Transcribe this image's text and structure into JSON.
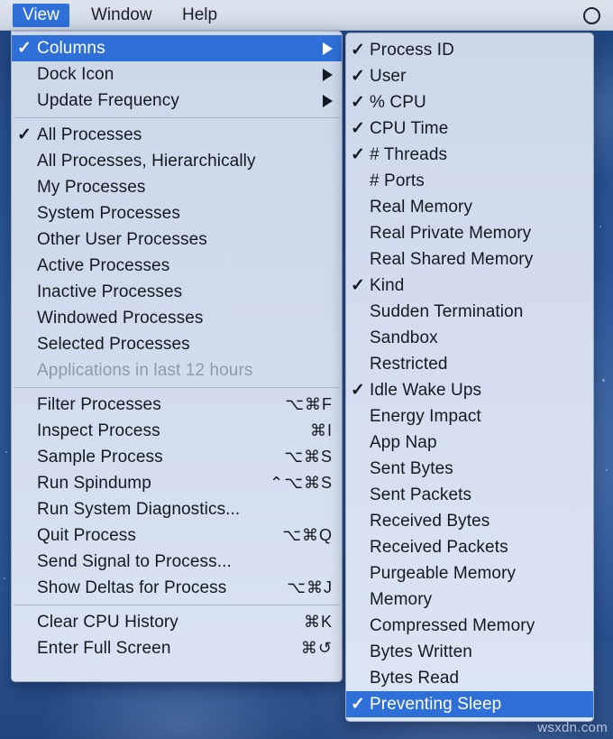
{
  "menubar": {
    "items": [
      {
        "label": "View",
        "active": true
      },
      {
        "label": "Window",
        "active": false
      },
      {
        "label": "Help",
        "active": false
      }
    ],
    "right_icon": "circle-icon"
  },
  "view_menu": {
    "groups": [
      {
        "name": "submenu-group",
        "items": [
          {
            "label": "Columns",
            "checked": true,
            "submenu": true,
            "selected": true,
            "shortcut": ""
          },
          {
            "label": "Dock Icon",
            "checked": false,
            "submenu": true,
            "selected": false,
            "shortcut": ""
          },
          {
            "label": "Update Frequency",
            "checked": false,
            "submenu": true,
            "selected": false,
            "shortcut": ""
          }
        ]
      },
      {
        "name": "process-filter-group",
        "items": [
          {
            "label": "All Processes",
            "checked": true,
            "submenu": false,
            "selected": false,
            "shortcut": ""
          },
          {
            "label": "All Processes, Hierarchically",
            "checked": false,
            "submenu": false,
            "selected": false,
            "shortcut": ""
          },
          {
            "label": "My Processes",
            "checked": false,
            "submenu": false,
            "selected": false,
            "shortcut": ""
          },
          {
            "label": "System Processes",
            "checked": false,
            "submenu": false,
            "selected": false,
            "shortcut": ""
          },
          {
            "label": "Other User Processes",
            "checked": false,
            "submenu": false,
            "selected": false,
            "shortcut": ""
          },
          {
            "label": "Active Processes",
            "checked": false,
            "submenu": false,
            "selected": false,
            "shortcut": ""
          },
          {
            "label": "Inactive Processes",
            "checked": false,
            "submenu": false,
            "selected": false,
            "shortcut": ""
          },
          {
            "label": "Windowed Processes",
            "checked": false,
            "submenu": false,
            "selected": false,
            "shortcut": ""
          },
          {
            "label": "Selected Processes",
            "checked": false,
            "submenu": false,
            "selected": false,
            "shortcut": ""
          },
          {
            "label": "Applications in last 12 hours",
            "checked": false,
            "submenu": false,
            "selected": false,
            "shortcut": "",
            "disabled": true
          }
        ]
      },
      {
        "name": "process-actions-group",
        "items": [
          {
            "label": "Filter Processes",
            "checked": false,
            "submenu": false,
            "selected": false,
            "shortcut": "⌥⌘F"
          },
          {
            "label": "Inspect Process",
            "checked": false,
            "submenu": false,
            "selected": false,
            "shortcut": "⌘I"
          },
          {
            "label": "Sample Process",
            "checked": false,
            "submenu": false,
            "selected": false,
            "shortcut": "⌥⌘S"
          },
          {
            "label": "Run Spindump",
            "checked": false,
            "submenu": false,
            "selected": false,
            "shortcut": "⌃⌥⌘S"
          },
          {
            "label": "Run System Diagnostics...",
            "checked": false,
            "submenu": false,
            "selected": false,
            "shortcut": ""
          },
          {
            "label": "Quit Process",
            "checked": false,
            "submenu": false,
            "selected": false,
            "shortcut": "⌥⌘Q"
          },
          {
            "label": "Send Signal to Process...",
            "checked": false,
            "submenu": false,
            "selected": false,
            "shortcut": ""
          },
          {
            "label": "Show Deltas for Process",
            "checked": false,
            "submenu": false,
            "selected": false,
            "shortcut": "⌥⌘J"
          }
        ]
      },
      {
        "name": "window-actions-group",
        "items": [
          {
            "label": "Clear CPU History",
            "checked": false,
            "submenu": false,
            "selected": false,
            "shortcut": "⌘K"
          },
          {
            "label": "Enter Full Screen",
            "checked": false,
            "submenu": false,
            "selected": false,
            "shortcut": "⌘↺"
          }
        ]
      }
    ]
  },
  "columns_menu": {
    "items": [
      {
        "label": "Process ID",
        "checked": true,
        "selected": false
      },
      {
        "label": "User",
        "checked": true,
        "selected": false
      },
      {
        "label": "% CPU",
        "checked": true,
        "selected": false
      },
      {
        "label": "CPU Time",
        "checked": true,
        "selected": false
      },
      {
        "label": "# Threads",
        "checked": true,
        "selected": false
      },
      {
        "label": "# Ports",
        "checked": false,
        "selected": false
      },
      {
        "label": "Real Memory",
        "checked": false,
        "selected": false
      },
      {
        "label": "Real Private Memory",
        "checked": false,
        "selected": false
      },
      {
        "label": "Real Shared Memory",
        "checked": false,
        "selected": false
      },
      {
        "label": "Kind",
        "checked": true,
        "selected": false
      },
      {
        "label": "Sudden Termination",
        "checked": false,
        "selected": false
      },
      {
        "label": "Sandbox",
        "checked": false,
        "selected": false
      },
      {
        "label": "Restricted",
        "checked": false,
        "selected": false
      },
      {
        "label": "Idle Wake Ups",
        "checked": true,
        "selected": false
      },
      {
        "label": "Energy Impact",
        "checked": false,
        "selected": false
      },
      {
        "label": "App Nap",
        "checked": false,
        "selected": false
      },
      {
        "label": "Sent Bytes",
        "checked": false,
        "selected": false
      },
      {
        "label": "Sent Packets",
        "checked": false,
        "selected": false
      },
      {
        "label": "Received Bytes",
        "checked": false,
        "selected": false
      },
      {
        "label": "Received Packets",
        "checked": false,
        "selected": false
      },
      {
        "label": "Purgeable Memory",
        "checked": false,
        "selected": false
      },
      {
        "label": "Memory",
        "checked": false,
        "selected": false
      },
      {
        "label": "Compressed Memory",
        "checked": false,
        "selected": false
      },
      {
        "label": "Bytes Written",
        "checked": false,
        "selected": false
      },
      {
        "label": "Bytes Read",
        "checked": false,
        "selected": false
      },
      {
        "label": "Preventing Sleep",
        "checked": true,
        "selected": true
      }
    ]
  },
  "watermark": {
    "text": "wsxdn.com"
  },
  "colors": {
    "highlight": "#2f70d8",
    "menu_bg": "#cdd8ea",
    "text": "#151920",
    "disabled_text": "#8e9aac",
    "desktop": "#2c5697"
  },
  "glyphs": {
    "check": "✓"
  }
}
